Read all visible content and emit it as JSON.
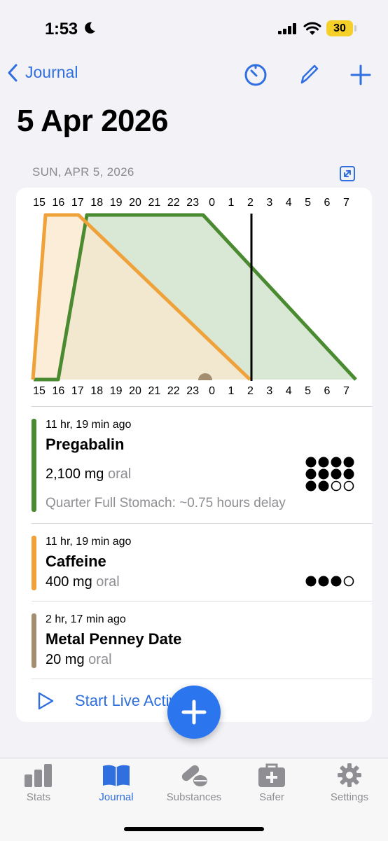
{
  "status_bar": {
    "time": "1:53",
    "battery": "30"
  },
  "nav": {
    "back_label": "Journal",
    "title": "5 Apr 2026"
  },
  "day_header": "SUN, APR 5, 2026",
  "timeline": {
    "hours": [
      "15",
      "16",
      "17",
      "18",
      "19",
      "20",
      "21",
      "22",
      "23",
      "0",
      "1",
      "2",
      "3",
      "4",
      "5",
      "6",
      "7"
    ],
    "series": [
      {
        "substance": "Pregabalin",
        "color": "#4a8a30",
        "fill": "#d6e7d3"
      },
      {
        "substance": "Caffeine",
        "color": "#f0a23a",
        "fill": "#fbe7cc"
      },
      {
        "substance": "Metal Penney Date",
        "color": "#a38e70"
      }
    ]
  },
  "entries": [
    {
      "ago": "11 hr, 19 min ago",
      "name": "Pregabalin",
      "dose": "2,100 mg",
      "route": "oral",
      "note": "Quarter Full Stomach: ~0.75 hours delay",
      "color": "#4a8a30",
      "dots_filled": 10,
      "dots_total": 12
    },
    {
      "ago": "11 hr, 19 min ago",
      "name": "Caffeine",
      "dose": "400 mg",
      "route": "oral",
      "color": "#f0a23a",
      "dots_filled": 3,
      "dots_total": 4
    },
    {
      "ago": "2 hr, 17 min ago",
      "name": "Metal Penney Date",
      "dose": "20 mg",
      "route": "oral",
      "color": "#a38e70"
    }
  ],
  "live_activity_label": "Start Live Activity",
  "tabs": [
    {
      "label": "Stats",
      "icon": "chart-bar-icon"
    },
    {
      "label": "Journal",
      "icon": "book-icon"
    },
    {
      "label": "Substances",
      "icon": "pills-icon"
    },
    {
      "label": "Safer",
      "icon": "medkit-icon"
    },
    {
      "label": "Settings",
      "icon": "gear-icon"
    }
  ]
}
